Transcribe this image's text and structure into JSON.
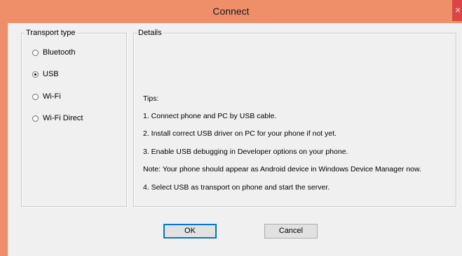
{
  "window": {
    "title": "Connect",
    "close_glyph": "×"
  },
  "transport": {
    "legend": "Transport type",
    "options": [
      {
        "label": "Bluetooth",
        "checked": false
      },
      {
        "label": "USB",
        "checked": true
      },
      {
        "label": "Wi-Fi",
        "checked": false
      },
      {
        "label": "Wi-Fi Direct",
        "checked": false
      }
    ]
  },
  "details": {
    "legend": "Details",
    "tips_heading": "Tips:",
    "lines": [
      "1. Connect phone and PC by USB cable.",
      "2. Install correct USB driver on PC for your phone if not yet.",
      "3. Enable USB debugging in Developer options on your phone.",
      "Note: Your phone should appear as Android device in Windows Device Manager now.",
      "4. Select USB as transport on phone and start the server."
    ]
  },
  "buttons": {
    "ok": "OK",
    "cancel": "Cancel"
  },
  "colors": {
    "titlebar": "#ef8f6a",
    "client": "#f0f0f0",
    "close": "#e04343"
  }
}
